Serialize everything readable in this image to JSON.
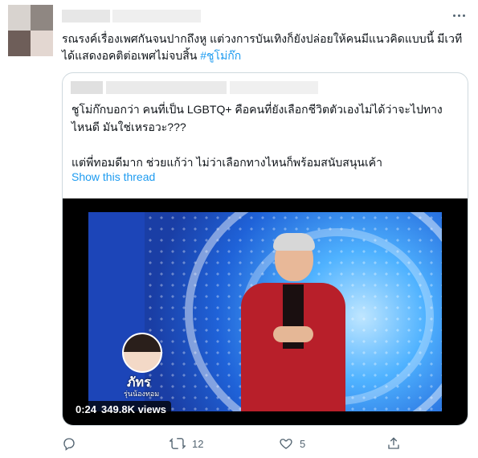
{
  "tweet": {
    "text": "รณรงค์เรื่องเพศกันจนปากถึงหู แต่วงการบันเทิงก็ยังปล่อยให้คนมีแนวคิดแบบนี้ มีเวทีได้แสดงอคติต่อเพศไม่จบสิ้น ",
    "hashtag": "#ชูโม่ก๊ก"
  },
  "quoted_tweet": {
    "text": "ชูโม่ก๊กบอกว่า คนที่เป็น LGBTQ+ คือคนที่ยังเลือกชีวิตตัวเองไม่ได้ว่าจะไปทางไหนดี มันใช่เหรอวะ???\n\nแต่พี่ทอมดีมาก ช่วยแก้ว่า ไม่ว่าเลือกทางไหนก็พร้อมสนับสนุนเค้า",
    "show_thread": "Show this thread"
  },
  "video": {
    "duration": "0:24",
    "views": "349.8K views",
    "inset_name": "ภัทร",
    "inset_subtitle": "รุ่นน้องทอม"
  },
  "actions": {
    "retweets": "12",
    "likes": "5"
  },
  "colors": {
    "accent": "#1d9bf0",
    "muted": "#536471",
    "border": "#cfd9de"
  },
  "icons": [
    "more-icon",
    "reply-icon",
    "retweet-icon",
    "like-icon",
    "share-icon"
  ]
}
